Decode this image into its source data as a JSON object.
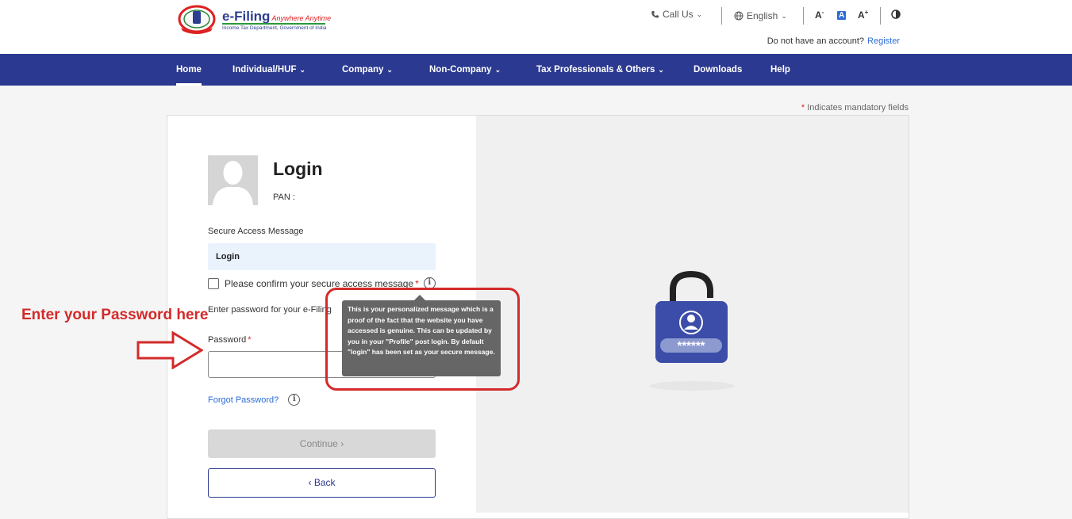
{
  "header": {
    "brand": "e-Filing",
    "tagline": "Anywhere Anytime",
    "subtitle": "Income Tax Department, Government of India",
    "call_us": "Call Us",
    "language": "English",
    "font_decrease": "A",
    "font_default": "A",
    "font_increase": "A",
    "no_account_text": "Do not have an account?",
    "register_link": "Register"
  },
  "nav": {
    "items": [
      {
        "label": "Home",
        "active": true
      },
      {
        "label": "Individual/HUF"
      },
      {
        "label": "Company"
      },
      {
        "label": "Non-Company"
      },
      {
        "label": "Tax Professionals & Others"
      },
      {
        "label": "Downloads"
      },
      {
        "label": "Help"
      }
    ]
  },
  "form": {
    "mandatory_star": "*",
    "mandatory_note": "Indicates mandatory fields",
    "title": "Login",
    "pan_label": "PAN :",
    "secure_access_label": "Secure Access Message",
    "secure_access_value": "Login",
    "confirm_label": "Please confirm your secure access message",
    "required_star": "*",
    "enter_password_text": "Enter password for your e-Filing",
    "password_label": "Password",
    "password_value": "",
    "forgot_password": "Forgot Password?",
    "continue_label": "Continue",
    "back_label": "Back"
  },
  "tooltip": {
    "text": "This is your personalized message which is a proof of the fact that the website you have accessed is genuine. This can be updated by you in your \"Profile\" post login. By default \"login\" has been set as your secure message."
  },
  "annotation": {
    "text": "Enter your Password here",
    "color": "#d42a2a"
  },
  "illustration": {
    "lock_text": "******"
  },
  "colors": {
    "nav_bg": "#2b3990",
    "link": "#2c6cd6",
    "annotation_red": "#d42a2a"
  }
}
